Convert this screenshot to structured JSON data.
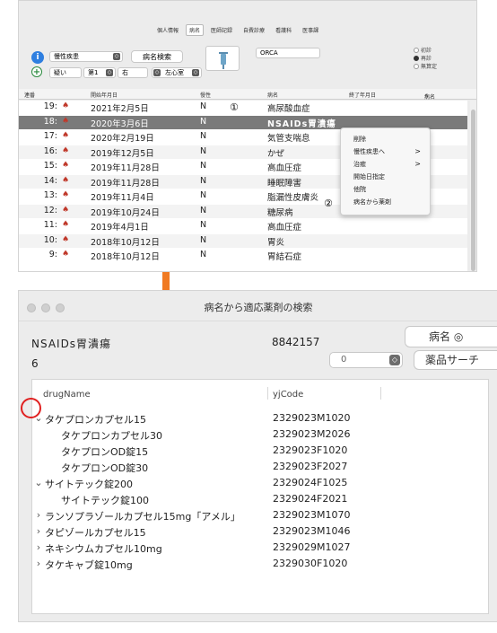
{
  "top_window": {
    "tabs": [
      "個人情報",
      "病名",
      "医師記録",
      "自費診療",
      "看護科",
      "医事課"
    ],
    "active_tab_index": 1,
    "toolbar": {
      "disease_type_select": "慢性疾患",
      "disease_search_button": "病名検索",
      "orca_label": "ORCA",
      "suspect_select": "疑い",
      "order_select": "第1",
      "side_select": "右",
      "site_select": "左心室",
      "radio_options": [
        "初診",
        "再診",
        "無算定"
      ],
      "radio_selected_index": 1
    },
    "grid": {
      "headers": [
        "連番",
        "開始年月日",
        "慢性",
        "病名",
        "終了年月日",
        "病名コメ…"
      ],
      "rows": [
        {
          "no": "19:",
          "date": "2021年2月5日",
          "chronic": "N",
          "name": "高尿酸血症"
        },
        {
          "no": "18:",
          "date": "2020年3月6日",
          "chronic": "N",
          "name": "NSAIDs胃潰瘍"
        },
        {
          "no": "17:",
          "date": "2020年2月19日",
          "chronic": "N",
          "name": "気管支喘息"
        },
        {
          "no": "16:",
          "date": "2019年12月5日",
          "chronic": "N",
          "name": "かぜ"
        },
        {
          "no": "15:",
          "date": "2019年11月28日",
          "chronic": "N",
          "name": "高血圧症"
        },
        {
          "no": "14:",
          "date": "2019年11月28日",
          "chronic": "N",
          "name": "睡眠障害"
        },
        {
          "no": "13:",
          "date": "2019年11月4日",
          "chronic": "N",
          "name": "脂漏性皮膚炎"
        },
        {
          "no": "12:",
          "date": "2019年10月24日",
          "chronic": "N",
          "name": "糖尿病"
        },
        {
          "no": "11:",
          "date": "2019年4月1日",
          "chronic": "N",
          "name": "高血圧症"
        },
        {
          "no": "10:",
          "date": "2018年10月12日",
          "chronic": "N",
          "name": "胃炎"
        },
        {
          "no": "9:",
          "date": "2018年10月12日",
          "chronic": "N",
          "name": "胃結石症"
        }
      ],
      "selected_row_index": 1
    },
    "context_menu": [
      {
        "label": "削除",
        "submenu": false
      },
      {
        "label": "慢性疾患へ",
        "submenu": true
      },
      {
        "label": "治癒",
        "submenu": true
      },
      {
        "label": "開始日指定",
        "submenu": false
      },
      {
        "label": "他院",
        "submenu": false
      },
      {
        "label": "病名から薬剤",
        "submenu": false
      }
    ],
    "markers": {
      "one": "①",
      "two": "②"
    }
  },
  "dialog": {
    "title": "病名から適応薬剤の検索",
    "disease_name": "NSAIDs胃潰瘍",
    "disease_code": "8842157",
    "count": "6",
    "name_button": "病名 ◎",
    "sort_select_value": "0",
    "search_button": "薬品サーチ",
    "columns": {
      "drug": "drugName",
      "code": "yjCode"
    },
    "rows": [
      {
        "indent": 0,
        "disclosure": "open",
        "name": "タケプロンカプセル15",
        "code": "2329023M1020"
      },
      {
        "indent": 1,
        "disclosure": "none",
        "name": "タケプロンカプセル30",
        "code": "2329023M2026"
      },
      {
        "indent": 1,
        "disclosure": "none",
        "name": "タケプロンOD錠15",
        "code": "2329023F1020"
      },
      {
        "indent": 1,
        "disclosure": "none",
        "name": "タケプロンOD錠30",
        "code": "2329023F2027"
      },
      {
        "indent": 0,
        "disclosure": "open",
        "name": "サイトテック錠200",
        "code": "2329024F1025"
      },
      {
        "indent": 1,
        "disclosure": "none",
        "name": "サイトテック錠100",
        "code": "2329024F2021"
      },
      {
        "indent": 0,
        "disclosure": "closed",
        "name": "ランソプラゾールカプセル15mg「アメル」",
        "code": "2329023M1070"
      },
      {
        "indent": 0,
        "disclosure": "closed",
        "name": "タピゾールカプセル15",
        "code": "2329023M1046"
      },
      {
        "indent": 0,
        "disclosure": "closed",
        "name": "ネキシウムカプセル10mg",
        "code": "2329029M1027"
      },
      {
        "indent": 0,
        "disclosure": "closed",
        "name": "タケキャブ錠10mg",
        "code": "2329030F1020"
      }
    ]
  },
  "colors": {
    "accent_arrow": "#f07a22",
    "highlight_circle": "#e02020",
    "flag": "#c0392b",
    "selected_row": "#7a7a7a"
  }
}
